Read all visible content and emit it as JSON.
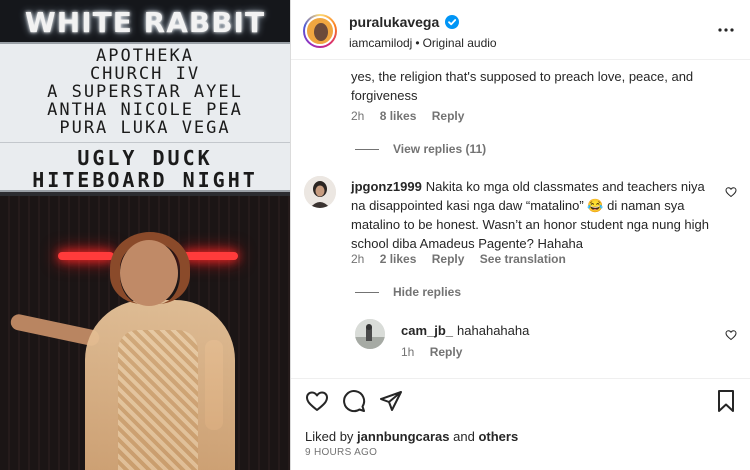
{
  "media": {
    "sign_brand": "WHITE RABBIT",
    "marquee_lines": [
      "APOTHEKA",
      "CHURCH IV",
      "A SUPERSTAR AYEL",
      "ANTHA NICOLE PEA",
      "PURA LUKA VEGA",
      "UGLY DUCK",
      "HITEBOARD NIGHT"
    ]
  },
  "post_header": {
    "username": "puraluka vega",
    "username_display": "puralukavega",
    "audio_author": "iamcamilodj",
    "audio_label": "Original audio"
  },
  "comments": [
    {
      "text": "yes, the religion that's supposed to preach love, peace, and forgiveness",
      "time": "2h",
      "likes": "8 likes",
      "reply": "Reply",
      "view_replies": "View replies (11)"
    },
    {
      "user": "jpgonz1999",
      "text": "Nakita ko mga old classmates and teachers niya na disappointed kasi nga daw “matalino” 😂 di naman sya matalino to be honest. Wasn’t an honor student nga nung high school diba Amadeus Pagente? Hahaha",
      "time": "2h",
      "likes": "2 likes",
      "reply": "Reply",
      "see_translation": "See translation",
      "hide_replies": "Hide replies"
    },
    {
      "user": "cam_jb_",
      "text": "hahahahaha",
      "time": "1h",
      "reply": "Reply"
    }
  ],
  "footer": {
    "liked_by_prefix": "Liked by",
    "liked_by_user": "jannbungcaras",
    "liked_by_and": "and",
    "liked_by_others": "others",
    "timestamp": "9 HOURS AGO"
  },
  "colors": {
    "text": "#262626",
    "muted": "#737373",
    "verified": "#0095f6",
    "border": "#dbdbdb"
  }
}
